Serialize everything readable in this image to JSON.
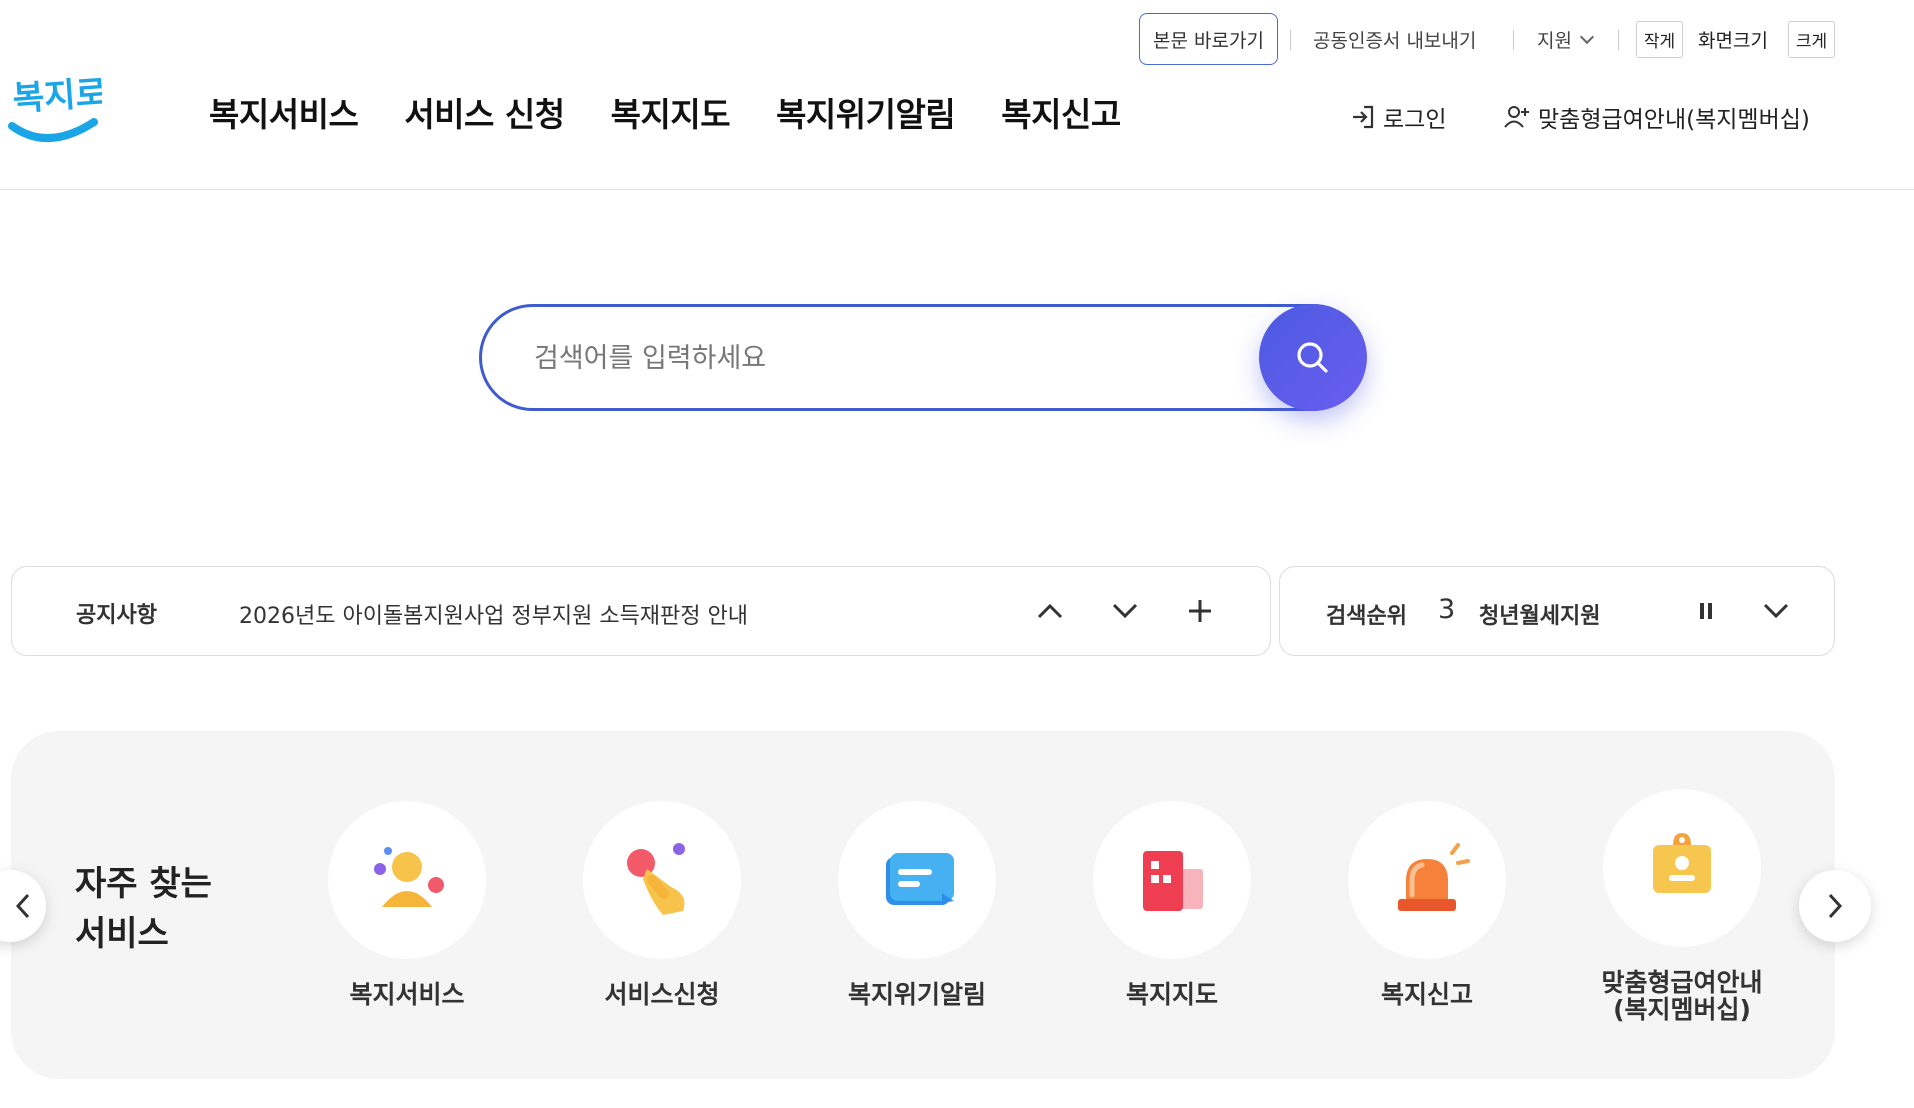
{
  "utility": {
    "skip_link": "본문 바로가기",
    "cert_export": "공동인증서 내보내기",
    "support": "지원",
    "size_small": "작게",
    "size_label": "화면크기",
    "size_large": "크게"
  },
  "header": {
    "logo_text": "복지로",
    "nav": [
      "복지서비스",
      "서비스 신청",
      "복지지도",
      "복지위기알림",
      "복지신고"
    ],
    "login": "로그인",
    "membership": "맞춤형급여안내(복지멤버십)"
  },
  "search": {
    "placeholder": "검색어를 입력하세요"
  },
  "notice": {
    "title": "공지사항",
    "text": "2026년도 아이돌봄지원사업 정부지원 소득재판정 안내"
  },
  "ranking": {
    "title": "검색순위",
    "number": "3",
    "keyword": "청년월세지원"
  },
  "favorites": {
    "title_line1": "자주 찾는",
    "title_line2": "서비스",
    "items": [
      {
        "label": "복지서비스",
        "icon": "person-icon"
      },
      {
        "label": "서비스신청",
        "icon": "hand-tap-icon"
      },
      {
        "label": "복지위기알림",
        "icon": "message-icon"
      },
      {
        "label": "복지지도",
        "icon": "building-map-icon"
      },
      {
        "label": "복지신고",
        "icon": "siren-icon"
      },
      {
        "label": "맞춤형급여안내\n(복지멤버십)",
        "icon": "id-badge-icon"
      }
    ]
  },
  "colors": {
    "brand_blue": "#3f5bd0",
    "logo_blue": "#1aa6e6",
    "search_button": "#5a5be8",
    "panel_bg": "#f5f5f5"
  }
}
